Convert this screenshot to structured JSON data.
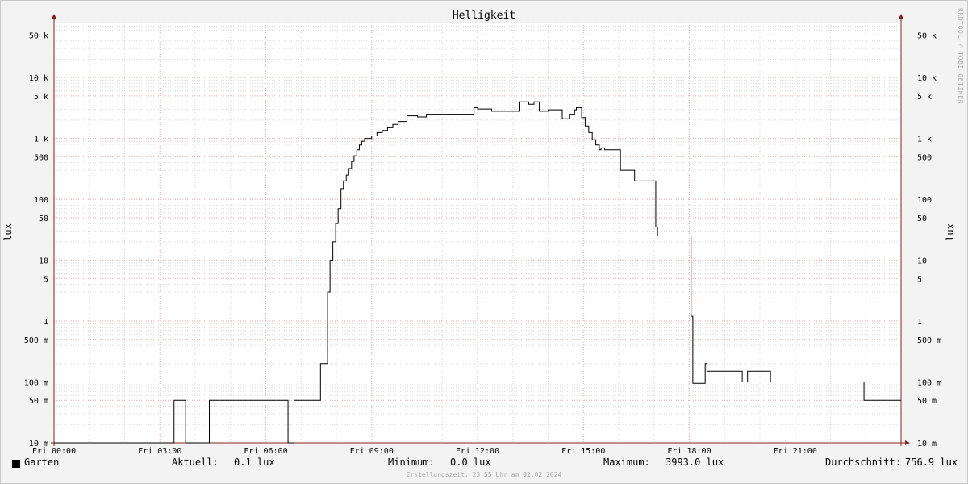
{
  "chart_data": {
    "type": "line",
    "title": "Helligkeit",
    "ylabel": "lux",
    "y_scale": "log",
    "ylim": [
      0.01,
      80000
    ],
    "x_range_hours": [
      0,
      24
    ],
    "x_ticks": [
      {
        "h": 0,
        "label": "Fri 00:00"
      },
      {
        "h": 3,
        "label": "Fri 03:00"
      },
      {
        "h": 6,
        "label": "Fri 06:00"
      },
      {
        "h": 9,
        "label": "Fri 09:00"
      },
      {
        "h": 12,
        "label": "Fri 12:00"
      },
      {
        "h": 15,
        "label": "Fri 15:00"
      },
      {
        "h": 18,
        "label": "Fri 18:00"
      },
      {
        "h": 21,
        "label": "Fri 21:00"
      }
    ],
    "y_ticks": [
      {
        "v": 0.01,
        "label": "10 m"
      },
      {
        "v": 0.05,
        "label": "50 m"
      },
      {
        "v": 0.1,
        "label": "100 m"
      },
      {
        "v": 0.5,
        "label": "500 m"
      },
      {
        "v": 1,
        "label": "1"
      },
      {
        "v": 5,
        "label": "5"
      },
      {
        "v": 10,
        "label": "10"
      },
      {
        "v": 50,
        "label": "50"
      },
      {
        "v": 100,
        "label": "100"
      },
      {
        "v": 500,
        "label": "500"
      },
      {
        "v": 1000,
        "label": "1 k"
      },
      {
        "v": 5000,
        "label": "5 k"
      },
      {
        "v": 10000,
        "label": "10 k"
      },
      {
        "v": 50000,
        "label": "50 k"
      }
    ],
    "grid": true,
    "series": [
      {
        "name": "Garten",
        "color": "#000000",
        "points": [
          [
            0,
            0.01
          ],
          [
            3.4,
            0.01
          ],
          [
            3.4,
            0.05
          ],
          [
            3.73,
            0.05
          ],
          [
            3.73,
            0.01
          ],
          [
            4.4,
            0.01
          ],
          [
            4.4,
            0.05
          ],
          [
            6.63,
            0.05
          ],
          [
            6.63,
            0.01
          ],
          [
            6.8,
            0.01
          ],
          [
            6.8,
            0.05
          ],
          [
            7.55,
            0.05
          ],
          [
            7.55,
            0.2
          ],
          [
            7.75,
            0.2
          ],
          [
            7.75,
            3
          ],
          [
            7.82,
            3
          ],
          [
            7.82,
            10
          ],
          [
            7.9,
            10
          ],
          [
            7.9,
            20
          ],
          [
            7.98,
            20
          ],
          [
            7.98,
            40
          ],
          [
            8.05,
            40
          ],
          [
            8.05,
            70
          ],
          [
            8.13,
            70
          ],
          [
            8.13,
            150
          ],
          [
            8.2,
            150
          ],
          [
            8.2,
            200
          ],
          [
            8.28,
            200
          ],
          [
            8.28,
            250
          ],
          [
            8.35,
            250
          ],
          [
            8.35,
            320
          ],
          [
            8.43,
            320
          ],
          [
            8.43,
            420
          ],
          [
            8.5,
            420
          ],
          [
            8.5,
            520
          ],
          [
            8.58,
            520
          ],
          [
            8.58,
            650
          ],
          [
            8.65,
            650
          ],
          [
            8.65,
            780
          ],
          [
            8.72,
            780
          ],
          [
            8.72,
            900
          ],
          [
            8.8,
            900
          ],
          [
            8.8,
            1000
          ],
          [
            9.0,
            1000
          ],
          [
            9.0,
            1100
          ],
          [
            9.15,
            1100
          ],
          [
            9.15,
            1250
          ],
          [
            9.3,
            1250
          ],
          [
            9.3,
            1350
          ],
          [
            9.45,
            1350
          ],
          [
            9.45,
            1500
          ],
          [
            9.6,
            1500
          ],
          [
            9.6,
            1700
          ],
          [
            9.75,
            1700
          ],
          [
            9.75,
            1900
          ],
          [
            10.0,
            1900
          ],
          [
            10.0,
            2350
          ],
          [
            10.3,
            2350
          ],
          [
            10.3,
            2250
          ],
          [
            10.55,
            2250
          ],
          [
            10.55,
            2500
          ],
          [
            11.9,
            2500
          ],
          [
            11.9,
            3200
          ],
          [
            12.0,
            3200
          ],
          [
            12.0,
            3050
          ],
          [
            12.4,
            3050
          ],
          [
            12.4,
            2800
          ],
          [
            13.2,
            2800
          ],
          [
            13.2,
            3993
          ],
          [
            13.45,
            3993
          ],
          [
            13.45,
            3650
          ],
          [
            13.6,
            3650
          ],
          [
            13.6,
            3993
          ],
          [
            13.75,
            3993
          ],
          [
            13.75,
            2800
          ],
          [
            14.0,
            2800
          ],
          [
            14.0,
            2950
          ],
          [
            14.4,
            2950
          ],
          [
            14.4,
            2100
          ],
          [
            14.6,
            2100
          ],
          [
            14.6,
            2500
          ],
          [
            14.75,
            2500
          ],
          [
            14.75,
            2950
          ],
          [
            14.8,
            2950
          ],
          [
            14.8,
            3200
          ],
          [
            14.95,
            3200
          ],
          [
            14.95,
            2200
          ],
          [
            15.05,
            2200
          ],
          [
            15.05,
            1600
          ],
          [
            15.15,
            1600
          ],
          [
            15.15,
            1250
          ],
          [
            15.25,
            1250
          ],
          [
            15.25,
            950
          ],
          [
            15.35,
            950
          ],
          [
            15.35,
            780
          ],
          [
            15.45,
            780
          ],
          [
            15.45,
            650
          ],
          [
            15.5,
            650
          ],
          [
            15.5,
            700
          ],
          [
            15.6,
            700
          ],
          [
            15.6,
            650
          ],
          [
            16.05,
            650
          ],
          [
            16.05,
            300
          ],
          [
            16.45,
            300
          ],
          [
            16.45,
            200
          ],
          [
            17.05,
            200
          ],
          [
            17.05,
            35
          ],
          [
            17.1,
            35
          ],
          [
            17.1,
            25
          ],
          [
            18.05,
            25
          ],
          [
            18.05,
            1.2
          ],
          [
            18.1,
            1.2
          ],
          [
            18.1,
            0.095
          ],
          [
            18.45,
            0.095
          ],
          [
            18.45,
            0.2
          ],
          [
            18.5,
            0.2
          ],
          [
            18.5,
            0.15
          ],
          [
            19.5,
            0.15
          ],
          [
            19.5,
            0.1
          ],
          [
            19.65,
            0.1
          ],
          [
            19.65,
            0.15
          ],
          [
            20.3,
            0.15
          ],
          [
            20.3,
            0.1
          ],
          [
            22.95,
            0.1
          ],
          [
            22.95,
            0.05
          ],
          [
            24.0,
            0.05
          ]
        ]
      }
    ]
  },
  "legend": {
    "series_name": "Garten",
    "aktuell_label": "Aktuell:",
    "aktuell_value": "0.1 lux",
    "minimum_label": "Minimum:",
    "minimum_value": "0.0 lux",
    "maximum_label": "Maximum:",
    "maximum_value": "3993.0 lux",
    "durchschnitt_label": "Durchschnitt:",
    "durchschnitt_value": "756.9 lux"
  },
  "footer": "Erstellungszeit: 23:55 Uhr am 02.02.2024",
  "watermark": "RRDTOOL / TOBI OETIKER",
  "colors": {
    "background": "#f3f3f3",
    "plot_background": "#ffffff",
    "major_grid": "#e9a2a2",
    "minor_grid": "#d8d8d8",
    "axis": "#8a2020",
    "line": "#000000"
  }
}
